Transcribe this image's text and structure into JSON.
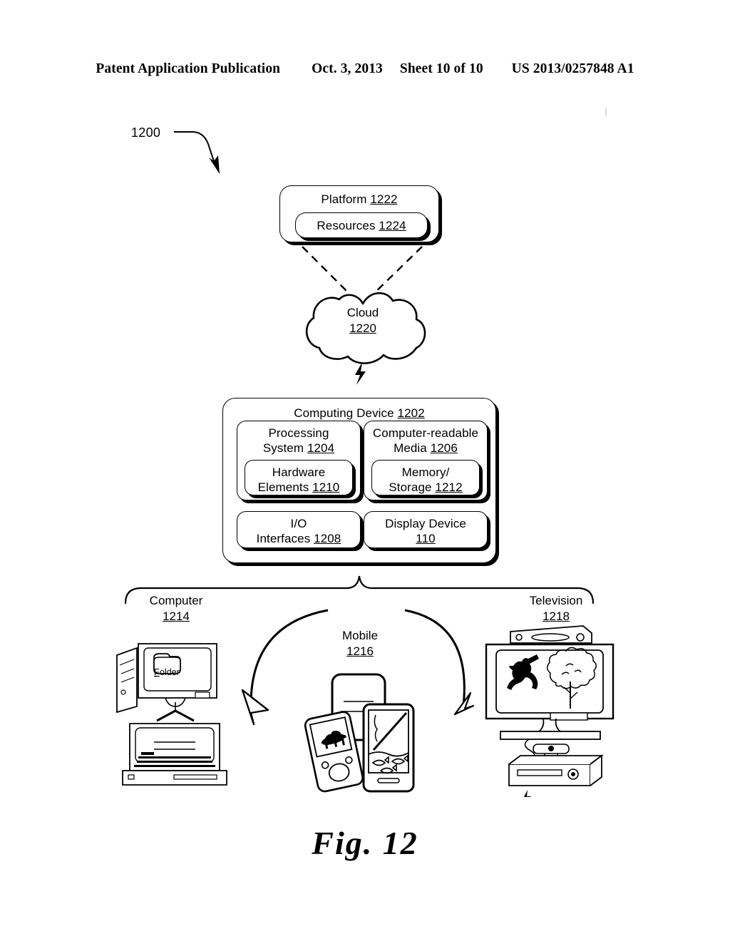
{
  "header": {
    "publication": "Patent Application Publication",
    "date": "Oct. 3, 2013",
    "sheet": "Sheet 10 of 10",
    "patent_number": "US 2013/0257848 A1"
  },
  "figure": {
    "callout": "1200",
    "caption": "Fig. 12"
  },
  "platform": {
    "label": "Platform",
    "ref": "1222",
    "resources": {
      "label": "Resources",
      "ref": "1224"
    }
  },
  "cloud": {
    "label": "Cloud",
    "ref": "1220"
  },
  "computing_device": {
    "label": "Computing Device",
    "ref": "1202",
    "blocks": [
      {
        "name": "processing-system",
        "line1": "Processing",
        "line2": "System",
        "ref": "1204"
      },
      {
        "name": "computer-readable-media",
        "line1": "Computer-readable",
        "line2": "Media",
        "ref": "1206"
      },
      {
        "name": "hardware-elements",
        "line1": "Hardware",
        "line2": "Elements",
        "ref": "1210"
      },
      {
        "name": "memory-storage",
        "line1": "Memory/",
        "line2": "Storage",
        "ref": "1212"
      },
      {
        "name": "io-interfaces",
        "line1": "I/O",
        "line2": "Interfaces",
        "ref": "1208"
      },
      {
        "name": "display-device",
        "line1": "Display Device",
        "line2": "",
        "ref": "110"
      }
    ]
  },
  "devices": [
    {
      "name": "computer",
      "label": "Computer",
      "ref": "1214",
      "screen_text": "Folder"
    },
    {
      "name": "mobile",
      "label": "Mobile",
      "ref": "1216"
    },
    {
      "name": "television",
      "label": "Television",
      "ref": "1218"
    }
  ],
  "colors": {
    "ink": "#000000",
    "paper": "#ffffff"
  }
}
